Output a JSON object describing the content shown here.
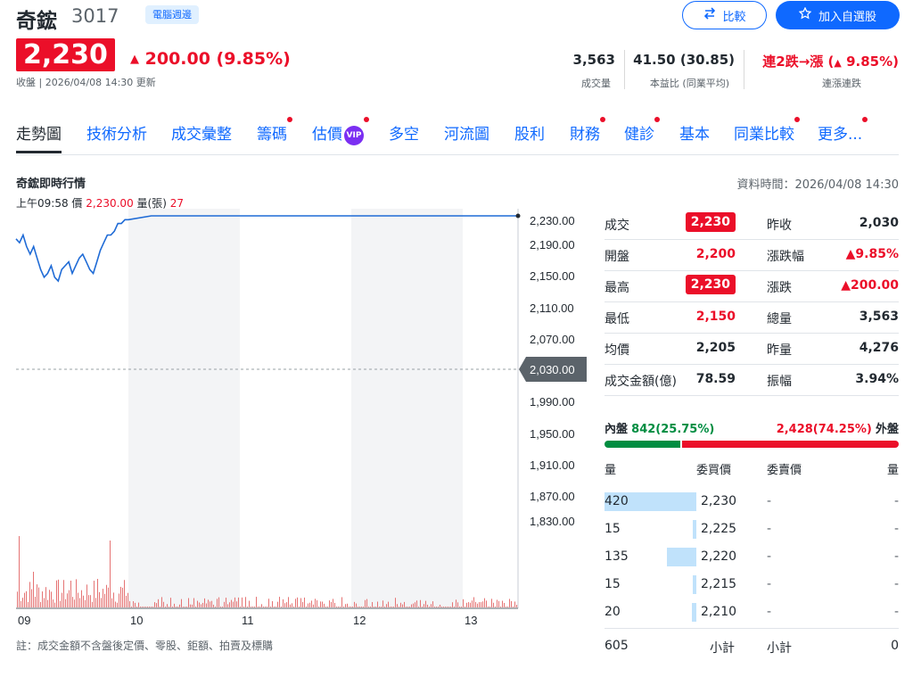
{
  "header": {
    "stock_name": "奇鋐",
    "stock_code": "3017",
    "category": "電腦週邊",
    "compare_label": "比較",
    "watchlist_label": "加入自選股",
    "price": "2,230",
    "change": "200.00 (9.85%)",
    "close_label": "收盤 | 2026/04/08 14:30 更新"
  },
  "stats": {
    "volume": "3,563",
    "volume_label": "成交量",
    "pe": "41.50 (30.85)",
    "pe_label": "本益比 (同業平均)",
    "streak": "連2跌→漲 (",
    "streak_pct": "9.85%)",
    "streak_label": "連漲連跌"
  },
  "tabs": [
    {
      "label": "走勢圖",
      "dot": false
    },
    {
      "label": "技術分析",
      "dot": false
    },
    {
      "label": "成交彙整",
      "dot": false
    },
    {
      "label": "籌碼",
      "dot": true
    },
    {
      "label": "估價",
      "dot": true,
      "vip": "VIP"
    },
    {
      "label": "多空",
      "dot": false
    },
    {
      "label": "河流圖",
      "dot": false
    },
    {
      "label": "股利",
      "dot": false
    },
    {
      "label": "財務",
      "dot": true
    },
    {
      "label": "健診",
      "dot": true
    },
    {
      "label": "基本",
      "dot": false
    },
    {
      "label": "同業比較",
      "dot": true
    },
    {
      "label": "更多...",
      "dot": true
    }
  ],
  "chart": {
    "title": "奇鋐即時行情",
    "data_time": "資料時間：2026/04/08 14:30",
    "info_time": "上午09:58",
    "info_price_label": "價",
    "info_price": "2,230.00",
    "info_vol_label": "量(張)",
    "info_vol": "27",
    "footnote": "註：成交金額不含盤後定價、零股、鉅額、拍賣及標購"
  },
  "chart_data": {
    "type": "line",
    "y_ticks": [
      "2,230.00",
      "2,190.00",
      "2,150.00",
      "2,110.00",
      "2,070.00",
      "2,030.00",
      "1,990.00",
      "1,950.00",
      "1,910.00",
      "1,870.00",
      "1,830.00"
    ],
    "x_ticks": [
      "09",
      "10",
      "11",
      "12",
      "13"
    ],
    "reference": 2030,
    "reference_label": "2,030.00",
    "ylim": [
      1830,
      2230
    ],
    "series": [
      {
        "values": [
          2200,
          2195,
          2205,
          2190,
          2180,
          2190,
          2175,
          2160,
          2150,
          2155,
          2165,
          2150,
          2145,
          2160,
          2165,
          2170,
          2155,
          2165,
          2175,
          2180,
          2170,
          2160,
          2155,
          2170,
          2185,
          2195,
          2205,
          2205,
          2210,
          2220,
          2220,
          2225,
          2225,
          2230,
          2230,
          2230,
          2230,
          2230,
          2230,
          2230,
          2230,
          2230,
          2230,
          2230,
          2230,
          2230,
          2230,
          2230,
          2230,
          2230
        ]
      }
    ]
  },
  "quote": {
    "rows": [
      {
        "l1": "成交",
        "v1": "2,230",
        "box1": true,
        "l2": "昨收",
        "v2": "2,030",
        "c2": "dark"
      },
      {
        "l1": "開盤",
        "v1": "2,200",
        "box1": false,
        "l2": "漲跌幅",
        "v2": "▲9.85%",
        "c2": "red"
      },
      {
        "l1": "最高",
        "v1": "2,230",
        "box1": true,
        "l2": "漲跌",
        "v2": "▲200.00",
        "c2": "red"
      },
      {
        "l1": "最低",
        "v1": "2,150",
        "box1": false,
        "l2": "總量",
        "v2": "3,563",
        "c2": "dark"
      },
      {
        "l1": "均價",
        "v1": "2,205",
        "box1": false,
        "v1dark": true,
        "l2": "昨量",
        "v2": "4,276",
        "c2": "dark"
      },
      {
        "l1": "成交金額(億)",
        "v1": "78.59",
        "box1": false,
        "v1dark": true,
        "l2": "振幅",
        "v2": "3.94%",
        "c2": "dark"
      }
    ],
    "inner_label": "內盤",
    "inner_value": "842(25.75%)",
    "outer_value": "2,428(74.25%)",
    "outer_label": "外盤",
    "inner_fraction": 0.2575
  },
  "orderbook": {
    "headers": [
      "量",
      "委買價",
      "委賣價",
      "量"
    ],
    "rows": [
      {
        "vol": "420",
        "price": "2,230",
        "fill": 1.0
      },
      {
        "vol": "15",
        "price": "2,225",
        "fill": 0.04
      },
      {
        "vol": "135",
        "price": "2,220",
        "fill": 0.32
      },
      {
        "vol": "15",
        "price": "2,215",
        "fill": 0.04
      },
      {
        "vol": "20",
        "price": "2,210",
        "fill": 0.05
      }
    ],
    "dash": "-",
    "total_vol": "605",
    "subtotal_label": "小計",
    "total_ask": "0"
  },
  "colors": {
    "up": "#eb0f29",
    "down": "#008d41",
    "accent": "#0f69ff",
    "line": "#1f6bd6"
  }
}
